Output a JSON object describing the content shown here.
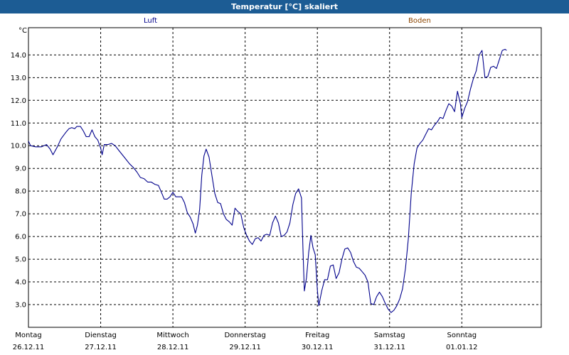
{
  "chart_data": {
    "type": "line",
    "title": "Temperatur [°C] skaliert",
    "ylabel": "°C",
    "xlabel": "",
    "ylim": [
      2.0,
      15.2
    ],
    "yticks": [
      3.0,
      4.0,
      5.0,
      6.0,
      7.0,
      8.0,
      9.0,
      10.0,
      11.0,
      12.0,
      13.0,
      14.0
    ],
    "grid": true,
    "legend_position": "top",
    "x_range_days": [
      0,
      7.1
    ],
    "x_tick_labels": [
      {
        "day": "Montag",
        "date": "26.12.11"
      },
      {
        "day": "Dienstag",
        "date": "27.12.11"
      },
      {
        "day": "Mittwoch",
        "date": "28.12.11"
      },
      {
        "day": "Donnerstag",
        "date": "29.12.11"
      },
      {
        "day": "Freitag",
        "date": "30.12.11"
      },
      {
        "day": "Samstag",
        "date": "31.12.11"
      },
      {
        "day": "Sonntag",
        "date": "01.01.12"
      }
    ],
    "series": [
      {
        "name": "Luft",
        "color": "#00008b",
        "points": [
          [
            0.0,
            10.2
          ],
          [
            0.03,
            10.0
          ],
          [
            0.1,
            9.95
          ],
          [
            0.18,
            9.95
          ],
          [
            0.25,
            10.05
          ],
          [
            0.3,
            9.85
          ],
          [
            0.34,
            9.6
          ],
          [
            0.4,
            9.95
          ],
          [
            0.45,
            10.3
          ],
          [
            0.52,
            10.6
          ],
          [
            0.56,
            10.75
          ],
          [
            0.6,
            10.8
          ],
          [
            0.64,
            10.75
          ],
          [
            0.67,
            10.85
          ],
          [
            0.72,
            10.85
          ],
          [
            0.76,
            10.65
          ],
          [
            0.8,
            10.4
          ],
          [
            0.84,
            10.4
          ],
          [
            0.88,
            10.7
          ],
          [
            0.92,
            10.4
          ],
          [
            0.96,
            10.25
          ],
          [
            1.0,
            9.9
          ],
          [
            1.02,
            9.6
          ],
          [
            1.05,
            10.05
          ],
          [
            1.1,
            10.05
          ],
          [
            1.15,
            10.1
          ],
          [
            1.2,
            10.0
          ],
          [
            1.25,
            9.8
          ],
          [
            1.3,
            9.6
          ],
          [
            1.35,
            9.4
          ],
          [
            1.4,
            9.2
          ],
          [
            1.45,
            9.05
          ],
          [
            1.5,
            8.85
          ],
          [
            1.55,
            8.6
          ],
          [
            1.6,
            8.55
          ],
          [
            1.65,
            8.4
          ],
          [
            1.7,
            8.4
          ],
          [
            1.75,
            8.3
          ],
          [
            1.8,
            8.25
          ],
          [
            1.84,
            7.95
          ],
          [
            1.88,
            7.65
          ],
          [
            1.92,
            7.65
          ],
          [
            1.96,
            7.75
          ],
          [
            2.0,
            7.95
          ],
          [
            2.04,
            7.75
          ],
          [
            2.08,
            7.75
          ],
          [
            2.12,
            7.75
          ],
          [
            2.16,
            7.5
          ],
          [
            2.2,
            7.05
          ],
          [
            2.24,
            6.85
          ],
          [
            2.28,
            6.55
          ],
          [
            2.31,
            6.15
          ],
          [
            2.34,
            6.5
          ],
          [
            2.37,
            7.2
          ],
          [
            2.4,
            8.7
          ],
          [
            2.43,
            9.55
          ],
          [
            2.46,
            9.85
          ],
          [
            2.5,
            9.5
          ],
          [
            2.54,
            8.7
          ],
          [
            2.58,
            7.9
          ],
          [
            2.62,
            7.5
          ],
          [
            2.66,
            7.45
          ],
          [
            2.7,
            7.0
          ],
          [
            2.74,
            6.75
          ],
          [
            2.78,
            6.65
          ],
          [
            2.82,
            6.5
          ],
          [
            2.86,
            7.25
          ],
          [
            2.9,
            7.1
          ],
          [
            2.94,
            7.0
          ],
          [
            2.98,
            6.4
          ],
          [
            3.02,
            6.05
          ],
          [
            3.06,
            5.8
          ],
          [
            3.1,
            5.65
          ],
          [
            3.14,
            5.9
          ],
          [
            3.18,
            5.95
          ],
          [
            3.22,
            5.8
          ],
          [
            3.26,
            6.05
          ],
          [
            3.3,
            6.1
          ],
          [
            3.34,
            6.05
          ],
          [
            3.38,
            6.6
          ],
          [
            3.42,
            6.9
          ],
          [
            3.46,
            6.6
          ],
          [
            3.5,
            6.0
          ],
          [
            3.54,
            6.05
          ],
          [
            3.58,
            6.2
          ],
          [
            3.62,
            6.6
          ],
          [
            3.66,
            7.4
          ],
          [
            3.7,
            7.9
          ],
          [
            3.74,
            8.1
          ],
          [
            3.78,
            7.7
          ],
          [
            3.8,
            5.5
          ],
          [
            3.82,
            3.6
          ],
          [
            3.85,
            4.2
          ],
          [
            3.88,
            5.3
          ],
          [
            3.91,
            6.05
          ],
          [
            3.94,
            5.5
          ],
          [
            3.97,
            5.2
          ],
          [
            4.0,
            3.65
          ],
          [
            4.02,
            2.95
          ],
          [
            4.06,
            3.6
          ],
          [
            4.1,
            4.1
          ],
          [
            4.14,
            4.1
          ],
          [
            4.18,
            4.7
          ],
          [
            4.22,
            4.75
          ],
          [
            4.26,
            4.15
          ],
          [
            4.3,
            4.4
          ],
          [
            4.34,
            5.0
          ],
          [
            4.38,
            5.45
          ],
          [
            4.42,
            5.5
          ],
          [
            4.46,
            5.3
          ],
          [
            4.5,
            4.9
          ],
          [
            4.54,
            4.65
          ],
          [
            4.58,
            4.6
          ],
          [
            4.62,
            4.45
          ],
          [
            4.66,
            4.3
          ],
          [
            4.7,
            4.0
          ],
          [
            4.74,
            3.05
          ],
          [
            4.78,
            3.0
          ],
          [
            4.82,
            3.35
          ],
          [
            4.86,
            3.55
          ],
          [
            4.9,
            3.35
          ],
          [
            4.94,
            3.05
          ],
          [
            4.98,
            2.8
          ],
          [
            5.02,
            2.65
          ],
          [
            5.06,
            2.75
          ],
          [
            5.1,
            2.95
          ],
          [
            5.14,
            3.25
          ],
          [
            5.18,
            3.7
          ],
          [
            5.22,
            4.6
          ],
          [
            5.26,
            5.9
          ],
          [
            5.3,
            7.9
          ],
          [
            5.34,
            9.2
          ],
          [
            5.38,
            9.9
          ],
          [
            5.42,
            10.1
          ],
          [
            5.46,
            10.25
          ],
          [
            5.5,
            10.5
          ],
          [
            5.54,
            10.75
          ],
          [
            5.58,
            10.7
          ],
          [
            5.62,
            10.9
          ],
          [
            5.66,
            11.05
          ],
          [
            5.7,
            11.25
          ],
          [
            5.74,
            11.2
          ],
          [
            5.78,
            11.55
          ],
          [
            5.82,
            11.85
          ],
          [
            5.86,
            11.75
          ],
          [
            5.9,
            11.5
          ],
          [
            5.94,
            12.4
          ],
          [
            5.98,
            11.85
          ],
          [
            6.0,
            11.25
          ],
          [
            6.04,
            11.65
          ],
          [
            6.08,
            11.95
          ],
          [
            6.12,
            12.5
          ],
          [
            6.16,
            12.95
          ],
          [
            6.2,
            13.3
          ],
          [
            6.24,
            14.0
          ],
          [
            6.28,
            14.2
          ],
          [
            6.32,
            13.0
          ],
          [
            6.36,
            13.05
          ],
          [
            6.4,
            13.45
          ],
          [
            6.44,
            13.5
          ],
          [
            6.48,
            13.4
          ],
          [
            6.52,
            13.8
          ],
          [
            6.56,
            14.2
          ],
          [
            6.6,
            14.25
          ],
          [
            6.62,
            14.2
          ]
        ]
      },
      {
        "name": "Boden",
        "color": "#8b4500",
        "points": []
      }
    ]
  }
}
